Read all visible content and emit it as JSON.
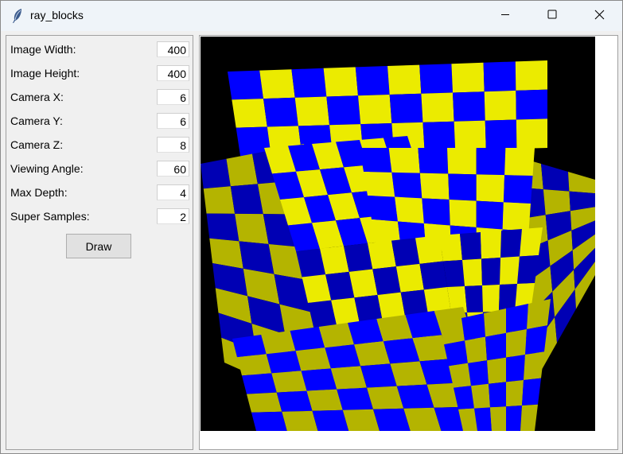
{
  "window": {
    "title": "ray_blocks",
    "icons": {
      "app": "feather-icon",
      "minimize": "minimize-icon",
      "maximize": "maximize-icon",
      "close": "close-icon"
    }
  },
  "form": {
    "fields": [
      {
        "label": "Image Width:",
        "value": "400"
      },
      {
        "label": "Image Height:",
        "value": "400"
      },
      {
        "label": "Camera X:",
        "value": "6"
      },
      {
        "label": "Camera Y:",
        "value": "6"
      },
      {
        "label": "Camera Z:",
        "value": "8"
      },
      {
        "label": "Viewing Angle:",
        "value": "60"
      },
      {
        "label": "Max Depth:",
        "value": "4"
      },
      {
        "label": "Super Samples:",
        "value": "2"
      }
    ],
    "draw_label": "Draw"
  },
  "render": {
    "background": "#000000",
    "colors": {
      "blue": "#0000ff",
      "blue_shade": "#0000b4",
      "yellow": "#ebeb00",
      "yellow_shade": "#b4b400"
    }
  }
}
